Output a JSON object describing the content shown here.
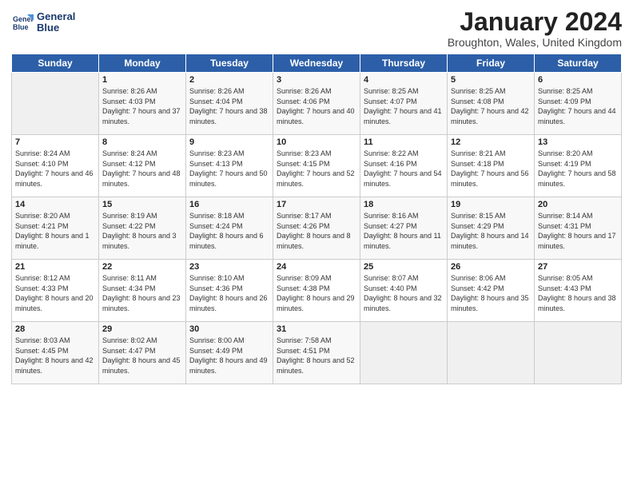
{
  "header": {
    "logo_line1": "General",
    "logo_line2": "Blue",
    "month": "January 2024",
    "location": "Broughton, Wales, United Kingdom"
  },
  "days_of_week": [
    "Sunday",
    "Monday",
    "Tuesday",
    "Wednesday",
    "Thursday",
    "Friday",
    "Saturday"
  ],
  "weeks": [
    [
      {
        "day": "",
        "sunrise": "",
        "sunset": "",
        "daylight": ""
      },
      {
        "day": "1",
        "sunrise": "Sunrise: 8:26 AM",
        "sunset": "Sunset: 4:03 PM",
        "daylight": "Daylight: 7 hours and 37 minutes."
      },
      {
        "day": "2",
        "sunrise": "Sunrise: 8:26 AM",
        "sunset": "Sunset: 4:04 PM",
        "daylight": "Daylight: 7 hours and 38 minutes."
      },
      {
        "day": "3",
        "sunrise": "Sunrise: 8:26 AM",
        "sunset": "Sunset: 4:06 PM",
        "daylight": "Daylight: 7 hours and 40 minutes."
      },
      {
        "day": "4",
        "sunrise": "Sunrise: 8:25 AM",
        "sunset": "Sunset: 4:07 PM",
        "daylight": "Daylight: 7 hours and 41 minutes."
      },
      {
        "day": "5",
        "sunrise": "Sunrise: 8:25 AM",
        "sunset": "Sunset: 4:08 PM",
        "daylight": "Daylight: 7 hours and 42 minutes."
      },
      {
        "day": "6",
        "sunrise": "Sunrise: 8:25 AM",
        "sunset": "Sunset: 4:09 PM",
        "daylight": "Daylight: 7 hours and 44 minutes."
      }
    ],
    [
      {
        "day": "7",
        "sunrise": "Sunrise: 8:24 AM",
        "sunset": "Sunset: 4:10 PM",
        "daylight": "Daylight: 7 hours and 46 minutes."
      },
      {
        "day": "8",
        "sunrise": "Sunrise: 8:24 AM",
        "sunset": "Sunset: 4:12 PM",
        "daylight": "Daylight: 7 hours and 48 minutes."
      },
      {
        "day": "9",
        "sunrise": "Sunrise: 8:23 AM",
        "sunset": "Sunset: 4:13 PM",
        "daylight": "Daylight: 7 hours and 50 minutes."
      },
      {
        "day": "10",
        "sunrise": "Sunrise: 8:23 AM",
        "sunset": "Sunset: 4:15 PM",
        "daylight": "Daylight: 7 hours and 52 minutes."
      },
      {
        "day": "11",
        "sunrise": "Sunrise: 8:22 AM",
        "sunset": "Sunset: 4:16 PM",
        "daylight": "Daylight: 7 hours and 54 minutes."
      },
      {
        "day": "12",
        "sunrise": "Sunrise: 8:21 AM",
        "sunset": "Sunset: 4:18 PM",
        "daylight": "Daylight: 7 hours and 56 minutes."
      },
      {
        "day": "13",
        "sunrise": "Sunrise: 8:20 AM",
        "sunset": "Sunset: 4:19 PM",
        "daylight": "Daylight: 7 hours and 58 minutes."
      }
    ],
    [
      {
        "day": "14",
        "sunrise": "Sunrise: 8:20 AM",
        "sunset": "Sunset: 4:21 PM",
        "daylight": "Daylight: 8 hours and 1 minute."
      },
      {
        "day": "15",
        "sunrise": "Sunrise: 8:19 AM",
        "sunset": "Sunset: 4:22 PM",
        "daylight": "Daylight: 8 hours and 3 minutes."
      },
      {
        "day": "16",
        "sunrise": "Sunrise: 8:18 AM",
        "sunset": "Sunset: 4:24 PM",
        "daylight": "Daylight: 8 hours and 6 minutes."
      },
      {
        "day": "17",
        "sunrise": "Sunrise: 8:17 AM",
        "sunset": "Sunset: 4:26 PM",
        "daylight": "Daylight: 8 hours and 8 minutes."
      },
      {
        "day": "18",
        "sunrise": "Sunrise: 8:16 AM",
        "sunset": "Sunset: 4:27 PM",
        "daylight": "Daylight: 8 hours and 11 minutes."
      },
      {
        "day": "19",
        "sunrise": "Sunrise: 8:15 AM",
        "sunset": "Sunset: 4:29 PM",
        "daylight": "Daylight: 8 hours and 14 minutes."
      },
      {
        "day": "20",
        "sunrise": "Sunrise: 8:14 AM",
        "sunset": "Sunset: 4:31 PM",
        "daylight": "Daylight: 8 hours and 17 minutes."
      }
    ],
    [
      {
        "day": "21",
        "sunrise": "Sunrise: 8:12 AM",
        "sunset": "Sunset: 4:33 PM",
        "daylight": "Daylight: 8 hours and 20 minutes."
      },
      {
        "day": "22",
        "sunrise": "Sunrise: 8:11 AM",
        "sunset": "Sunset: 4:34 PM",
        "daylight": "Daylight: 8 hours and 23 minutes."
      },
      {
        "day": "23",
        "sunrise": "Sunrise: 8:10 AM",
        "sunset": "Sunset: 4:36 PM",
        "daylight": "Daylight: 8 hours and 26 minutes."
      },
      {
        "day": "24",
        "sunrise": "Sunrise: 8:09 AM",
        "sunset": "Sunset: 4:38 PM",
        "daylight": "Daylight: 8 hours and 29 minutes."
      },
      {
        "day": "25",
        "sunrise": "Sunrise: 8:07 AM",
        "sunset": "Sunset: 4:40 PM",
        "daylight": "Daylight: 8 hours and 32 minutes."
      },
      {
        "day": "26",
        "sunrise": "Sunrise: 8:06 AM",
        "sunset": "Sunset: 4:42 PM",
        "daylight": "Daylight: 8 hours and 35 minutes."
      },
      {
        "day": "27",
        "sunrise": "Sunrise: 8:05 AM",
        "sunset": "Sunset: 4:43 PM",
        "daylight": "Daylight: 8 hours and 38 minutes."
      }
    ],
    [
      {
        "day": "28",
        "sunrise": "Sunrise: 8:03 AM",
        "sunset": "Sunset: 4:45 PM",
        "daylight": "Daylight: 8 hours and 42 minutes."
      },
      {
        "day": "29",
        "sunrise": "Sunrise: 8:02 AM",
        "sunset": "Sunset: 4:47 PM",
        "daylight": "Daylight: 8 hours and 45 minutes."
      },
      {
        "day": "30",
        "sunrise": "Sunrise: 8:00 AM",
        "sunset": "Sunset: 4:49 PM",
        "daylight": "Daylight: 8 hours and 49 minutes."
      },
      {
        "day": "31",
        "sunrise": "Sunrise: 7:58 AM",
        "sunset": "Sunset: 4:51 PM",
        "daylight": "Daylight: 8 hours and 52 minutes."
      },
      {
        "day": "",
        "sunrise": "",
        "sunset": "",
        "daylight": ""
      },
      {
        "day": "",
        "sunrise": "",
        "sunset": "",
        "daylight": ""
      },
      {
        "day": "",
        "sunrise": "",
        "sunset": "",
        "daylight": ""
      }
    ]
  ]
}
